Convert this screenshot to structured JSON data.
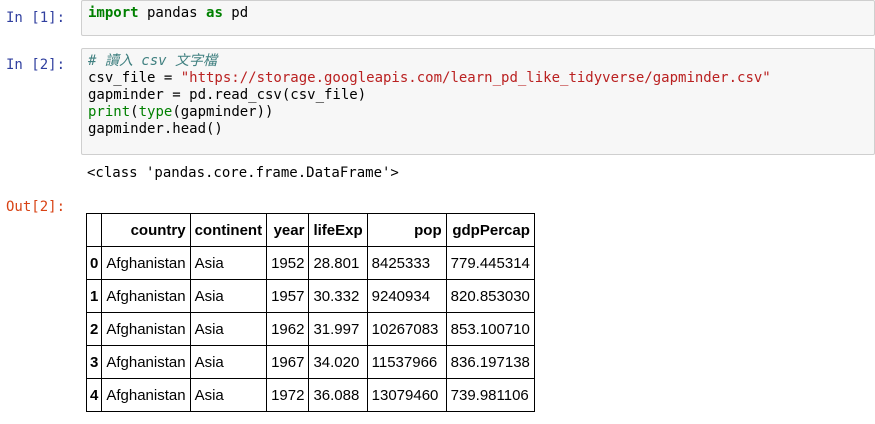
{
  "cells": [
    {
      "prompt": "In [1]:",
      "code": {
        "kw1": "import",
        "mid": " pandas ",
        "kw2": "as",
        "end": " pd"
      }
    },
    {
      "prompt": "In [2]:",
      "code": {
        "comment": "# 讀入 csv 文字檔",
        "line2_pre": "csv_file = ",
        "line2_str": "\"https://storage.googleapis.com/learn_pd_like_tidyverse/gapminder.csv\"",
        "line3": "gapminder = pd.read_csv(csv_file)",
        "line4_print": "print",
        "line4_open": "(",
        "line4_type": "type",
        "line4_rest": "(gapminder))",
        "line5": "gapminder.head()"
      },
      "stdout": "<class 'pandas.core.frame.DataFrame'>",
      "out_prompt": "Out[2]:"
    }
  ],
  "table": {
    "columns": [
      "country",
      "continent",
      "year",
      "lifeExp",
      "pop",
      "gdpPercap"
    ],
    "index": [
      "0",
      "1",
      "2",
      "3",
      "4"
    ],
    "rows": [
      [
        "Afghanistan",
        "Asia",
        "1952",
        "28.801",
        "8425333",
        "779.445314"
      ],
      [
        "Afghanistan",
        "Asia",
        "1957",
        "30.332",
        "9240934",
        "820.853030"
      ],
      [
        "Afghanistan",
        "Asia",
        "1962",
        "31.997",
        "10267083",
        "853.100710"
      ],
      [
        "Afghanistan",
        "Asia",
        "1967",
        "34.020",
        "11537966",
        "836.197138"
      ],
      [
        "Afghanistan",
        "Asia",
        "1972",
        "36.088",
        "13079460",
        "739.981106"
      ]
    ]
  },
  "colors": {
    "in_prompt": "#303f9f",
    "out_prompt": "#d84315",
    "keyword": "#008000",
    "string": "#ba2121",
    "comment": "#408080",
    "cell_bg": "#f7f7f7"
  }
}
